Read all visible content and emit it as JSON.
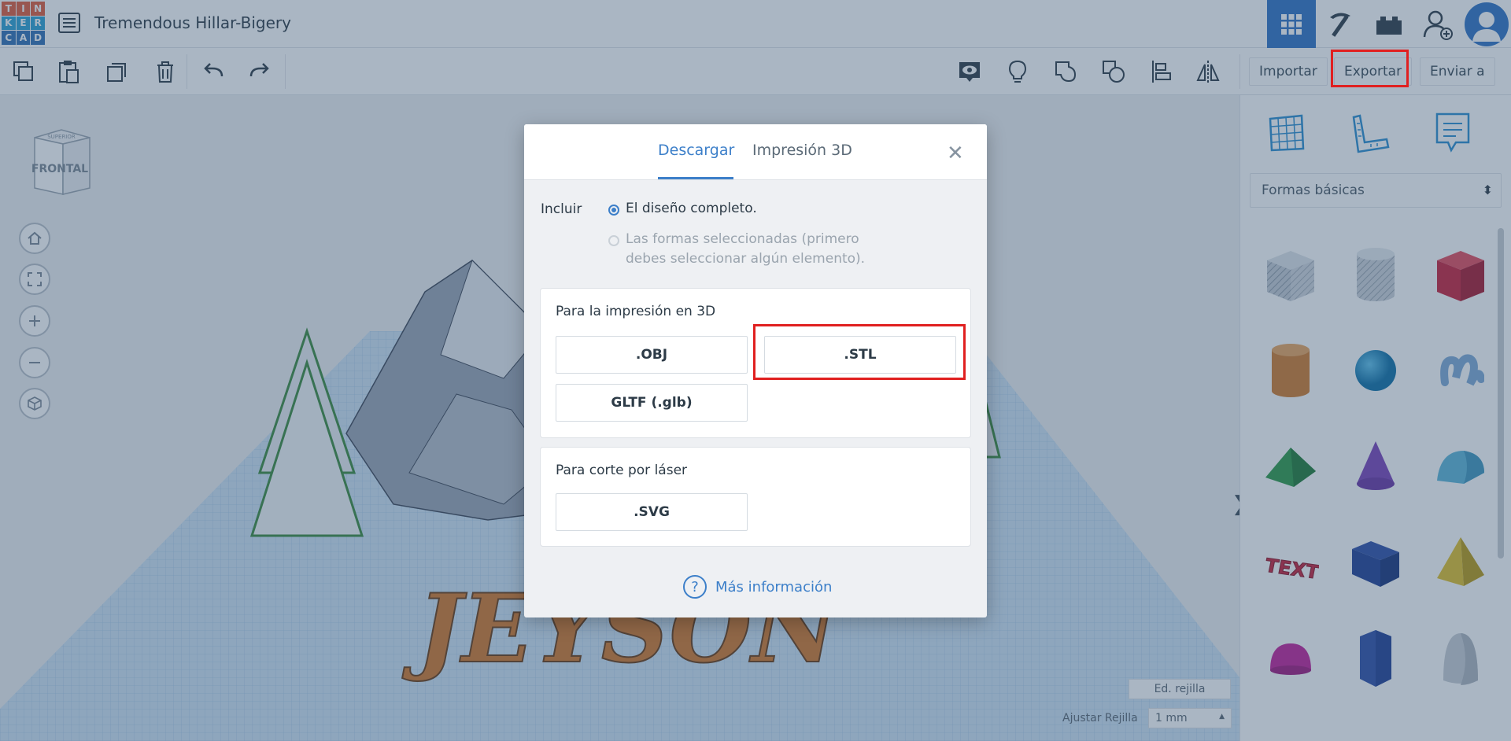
{
  "app": {
    "logo_letters": [
      "T",
      "I",
      "N",
      "K",
      "E",
      "R",
      "C",
      "A",
      "D"
    ],
    "logo_colors": [
      "#e05a3a",
      "#e05a3a",
      "#e05a3a",
      "#2aa1d5",
      "#2aa1d5",
      "#2aa1d5",
      "#2f6eb5",
      "#2f6eb5",
      "#2f6eb5"
    ],
    "design_title": "Tremendous Hillar-Bigery"
  },
  "toolbar": {
    "import_label": "Importar",
    "export_label": "Exportar",
    "send_label": "Enviar a"
  },
  "workplane": {
    "viewcube_top": "SUPERIOR",
    "viewcube_front": "FRONTAL",
    "grid_edit_label": "Ed. rejilla",
    "snap_label": "Ajustar Rejilla",
    "snap_value": "1 mm",
    "text_object": "JEYSON"
  },
  "panel": {
    "category": "Formas básicas",
    "shapes": [
      "box-hole",
      "cylinder-hole",
      "box",
      "cylinder",
      "sphere",
      "scribble",
      "roof",
      "cone",
      "round-roof",
      "text",
      "wedge",
      "pyramid",
      "half-sphere",
      "polygon",
      "paraboloid"
    ]
  },
  "modal": {
    "tab_download": "Descargar",
    "tab_print": "Impresión 3D",
    "include_label": "Incluir",
    "option_full": "El diseño completo.",
    "option_selected_line1": "Las formas seleccionadas (primero",
    "option_selected_line2": "debes seleccionar algún elemento).",
    "print_section_title": "Para la impresión en 3D",
    "btn_obj": ".OBJ",
    "btn_stl": ".STL",
    "btn_gltf": "GLTF (.glb)",
    "laser_section_title": "Para corte por láser",
    "btn_svg": ".SVG",
    "help_label": "Más información"
  },
  "colors": {
    "accent": "#3c7fc9",
    "highlight": "#e02020",
    "active_top": "#2f72c4"
  }
}
